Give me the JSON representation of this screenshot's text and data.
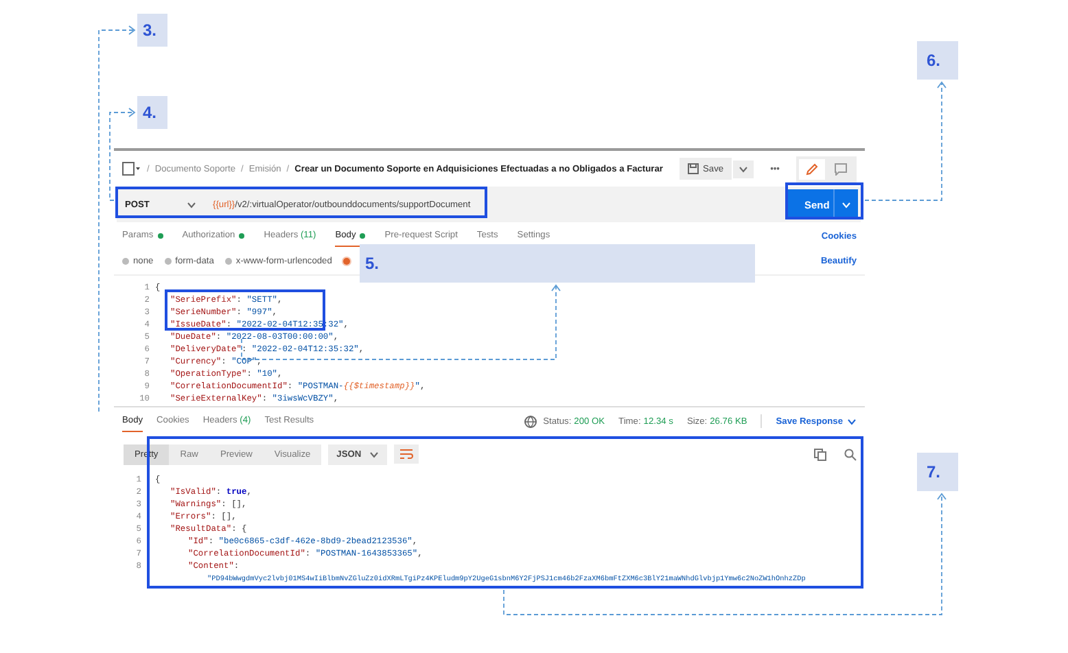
{
  "callouts": [
    {
      "label": "3."
    },
    {
      "label": "4."
    },
    {
      "label": "5."
    },
    {
      "label": "6."
    },
    {
      "label": "7."
    }
  ],
  "header": {
    "breadcrumb": [
      {
        "separator": "/",
        "label": "Documento Soporte"
      },
      {
        "separator": "/",
        "label": "Emisión"
      }
    ],
    "title_separator": "/",
    "title": "Crear un Documento Soporte en Adquisiciones Efectuadas a no Obligados a Facturar",
    "save": "Save",
    "more": "•••"
  },
  "request": {
    "method": "POST",
    "url_variable": "{{url}}",
    "url_path": "/v2/:virtualOperator/outbounddocuments/supportDocument",
    "send": "Send"
  },
  "tabs": [
    {
      "label": "Params",
      "dot": true,
      "selected": false
    },
    {
      "label": "Authorization",
      "dot": true,
      "selected": false
    },
    {
      "label": "Headers",
      "count": "(11)",
      "dot": false,
      "selected": false
    },
    {
      "label": "Body",
      "dot": true,
      "selected": true
    },
    {
      "label": "Pre-request Script",
      "dot": false,
      "selected": false
    },
    {
      "label": "Tests",
      "dot": false,
      "selected": false
    },
    {
      "label": "Settings",
      "dot": false,
      "selected": false
    }
  ],
  "cookies": "Cookies",
  "body_types": [
    {
      "label": "none",
      "selected": false
    },
    {
      "label": "form-data",
      "selected": false
    },
    {
      "label": "x-www-form-urlencoded",
      "selected": false
    },
    {
      "selected": true
    }
  ],
  "beautify": "Beautify",
  "request_body": [
    {
      "n": "1",
      "kind": "root",
      "tokens": [
        {
          "kind": "punct",
          "text": "{"
        }
      ]
    },
    {
      "n": "2",
      "kind": "field",
      "tokens": [
        {
          "kind": "key",
          "text": "\"SeriePrefix\""
        },
        {
          "kind": "punct",
          "text": ": "
        },
        {
          "kind": "str",
          "text": "\"SETT\""
        },
        {
          "kind": "punct",
          "text": ","
        }
      ]
    },
    {
      "n": "3",
      "kind": "field",
      "tokens": [
        {
          "kind": "key",
          "text": "\"SerieNumber\""
        },
        {
          "kind": "punct",
          "text": ": "
        },
        {
          "kind": "str",
          "text": "\"997\""
        },
        {
          "kind": "punct",
          "text": ","
        }
      ]
    },
    {
      "n": "4",
      "kind": "field",
      "tokens": [
        {
          "kind": "key",
          "text": "\"IssueDate\""
        },
        {
          "kind": "punct",
          "text": ": "
        },
        {
          "kind": "str",
          "text": "\"2022-02-04T12:35:32\""
        },
        {
          "kind": "punct",
          "text": ","
        }
      ]
    },
    {
      "n": "5",
      "kind": "field",
      "tokens": [
        {
          "kind": "key",
          "text": "\"DueDate\""
        },
        {
          "kind": "punct",
          "text": ": "
        },
        {
          "kind": "str",
          "text": "\"2022-08-03T00:00:00\""
        },
        {
          "kind": "punct",
          "text": ","
        }
      ]
    },
    {
      "n": "6",
      "kind": "field",
      "tokens": [
        {
          "kind": "key",
          "text": "\"DeliveryDate\""
        },
        {
          "kind": "punct",
          "text": ": "
        },
        {
          "kind": "str",
          "text": "\"2022-02-04T12:35:32\""
        },
        {
          "kind": "punct",
          "text": ","
        }
      ]
    },
    {
      "n": "7",
      "kind": "field",
      "tokens": [
        {
          "kind": "key",
          "text": "\"Currency\""
        },
        {
          "kind": "punct",
          "text": ": "
        },
        {
          "kind": "str",
          "text": "\"COP\""
        },
        {
          "kind": "punct",
          "text": ","
        }
      ]
    },
    {
      "n": "8",
      "kind": "field",
      "tokens": [
        {
          "kind": "key",
          "text": "\"OperationType\""
        },
        {
          "kind": "punct",
          "text": ": "
        },
        {
          "kind": "str",
          "text": "\"10\""
        },
        {
          "kind": "punct",
          "text": ","
        }
      ]
    },
    {
      "n": "9",
      "kind": "field",
      "tokens": [
        {
          "kind": "key",
          "text": "\"CorrelationDocumentId\""
        },
        {
          "kind": "punct",
          "text": ": "
        },
        {
          "kind": "str",
          "text": "\"POSTMAN-"
        },
        {
          "kind": "var",
          "text": "{{$timestamp}}"
        },
        {
          "kind": "str",
          "text": "\""
        },
        {
          "kind": "punct",
          "text": ","
        }
      ]
    },
    {
      "n": "10",
      "kind": "field",
      "tokens": [
        {
          "kind": "key",
          "text": "\"SerieExternalKey\""
        },
        {
          "kind": "punct",
          "text": ": "
        },
        {
          "kind": "str",
          "text": "\"3iwsWcVBZY\""
        },
        {
          "kind": "punct",
          "text": ","
        }
      ]
    }
  ],
  "response_tabs": [
    {
      "label": "Body",
      "selected": true
    },
    {
      "label": "Cookies",
      "selected": false
    },
    {
      "label": "Headers",
      "count": "(4)",
      "selected": false
    },
    {
      "label": "Test Results",
      "selected": false
    }
  ],
  "status": {
    "status_label": "Status:",
    "status": "200 OK",
    "time_label": "Time:",
    "time": "12.34 s",
    "size_label": "Size:",
    "size": "26.76 KB"
  },
  "save_response": "Save Response",
  "view_modes": [
    {
      "label": "Pretty",
      "selected": true
    },
    {
      "label": "Raw",
      "selected": false
    },
    {
      "label": "Preview",
      "selected": false
    },
    {
      "label": "Visualize",
      "selected": false
    }
  ],
  "format": "JSON",
  "response_body": [
    {
      "n": "1",
      "kind": "root",
      "tokens": [
        {
          "kind": "punct",
          "text": "{"
        }
      ]
    },
    {
      "n": "2",
      "kind": "field",
      "tokens": [
        {
          "kind": "key",
          "text": "\"IsValid\""
        },
        {
          "kind": "punct",
          "text": ": "
        },
        {
          "kind": "bool",
          "text": "true"
        },
        {
          "kind": "punct",
          "text": ","
        }
      ]
    },
    {
      "n": "3",
      "kind": "field",
      "tokens": [
        {
          "kind": "key",
          "text": "\"Warnings\""
        },
        {
          "kind": "punct",
          "text": ": [],"
        }
      ]
    },
    {
      "n": "4",
      "kind": "field",
      "tokens": [
        {
          "kind": "key",
          "text": "\"Errors\""
        },
        {
          "kind": "punct",
          "text": ": [],"
        }
      ]
    },
    {
      "n": "5",
      "kind": "field",
      "tokens": [
        {
          "kind": "key",
          "text": "\"ResultData\""
        },
        {
          "kind": "punct",
          "text": ": {"
        }
      ]
    },
    {
      "n": "6",
      "kind": "nested",
      "tokens": [
        {
          "kind": "key",
          "text": "\"Id\""
        },
        {
          "kind": "punct",
          "text": ": "
        },
        {
          "kind": "str",
          "text": "\"be0c6865-c3df-462e-8bd9-2bead2123536\""
        },
        {
          "kind": "punct",
          "text": ","
        }
      ]
    },
    {
      "n": "7",
      "kind": "nested",
      "tokens": [
        {
          "kind": "key",
          "text": "\"CorrelationDocumentId\""
        },
        {
          "kind": "punct",
          "text": ": "
        },
        {
          "kind": "str",
          "text": "\"POSTMAN-1643853365\""
        },
        {
          "kind": "punct",
          "text": ","
        }
      ]
    },
    {
      "n": "8",
      "kind": "nested",
      "tokens": [
        {
          "kind": "key",
          "text": "\"Content\""
        },
        {
          "kind": "punct",
          "text": ":"
        }
      ]
    },
    {
      "kind": "content",
      "tokens": [
        {
          "kind": "str",
          "text": "\"PD94bWwgdmVyc2lvbj01MS4wIiBlbmNvZGluZz0idXRmLTgiPz4KPEludm9pY2UgeG1sbnM6Y2FjPSJ1cm46b2FzaXM6bmFtZXM6c3BlY21maWNhdGlvbjp1Ymw6c2NoZW1hOnhzZDp"
        }
      ]
    }
  ]
}
